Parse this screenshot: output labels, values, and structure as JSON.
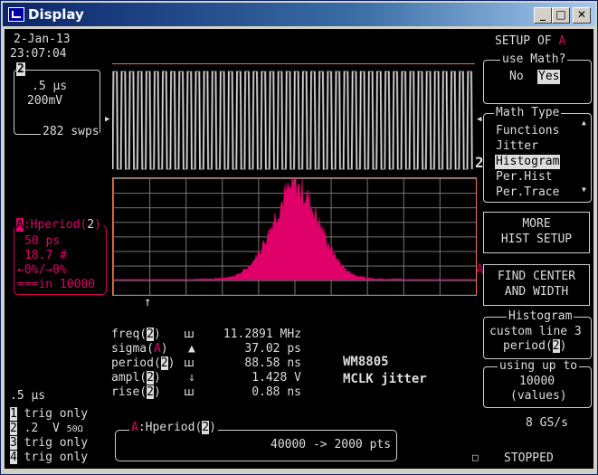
{
  "window": {
    "title": "Display"
  },
  "header": {
    "date": "2-Jan-13",
    "time": "23:07:04",
    "setup": "SETUP OF",
    "setup_trace": "A"
  },
  "channel_box": {
    "number": "2",
    "timebase": ".5 μs",
    "volts": "200mV",
    "sweeps": "282 swps"
  },
  "waveform_marker": "2",
  "hist_marker": "A",
  "param_box": {
    "letter": "A",
    "label": ":Hperiod(",
    "chan": "2",
    "close": ")",
    "bin": "50 ps",
    "count": "18.7 #",
    "range": "←0%/→0%",
    "total": "===in 10000"
  },
  "measurements": [
    {
      "name": "freq(",
      "ch": "2",
      "close": ")",
      "icon": "ꟺ",
      "value": "11.2891 MHz",
      "magenta": false
    },
    {
      "name": "sigma(",
      "ch": "A",
      "close": ")",
      "icon": "▲",
      "value": "37.02 ps",
      "magenta": true
    },
    {
      "name": "period(",
      "ch": "2",
      "close": ")",
      "icon": "ꟺ",
      "value": "88.58 ns",
      "magenta": false
    },
    {
      "name": "ampl(",
      "ch": "2",
      "close": ")",
      "icon": "⇓",
      "value": "1.428 V",
      "magenta": false
    },
    {
      "name": "rise(",
      "ch": "2",
      "close": ")",
      "icon": "ꟺ",
      "value": "0.88 ns",
      "magenta": false
    }
  ],
  "annotation": {
    "line1": "WM8805",
    "line2": "MCLK jitter"
  },
  "bottom_left": {
    "timebase": ".5 μs",
    "ch1": "trig only",
    "ch2_volts": ".2  V",
    "ch2_imp": "50Ω",
    "ch3": "trig only",
    "ch4": "trig only"
  },
  "bottom_box": {
    "letter": "A",
    "label": ":Hperiod(",
    "chan": "2",
    "close": ")",
    "value": "40000 -> 2000 pts"
  },
  "sample_rate": "8 GS/s",
  "status": "STOPPED",
  "menu": {
    "use_math": {
      "title": "use Math?",
      "no": "No",
      "yes": "Yes"
    },
    "math_type": {
      "title": "Math Type",
      "options": [
        "Functions",
        "Jitter",
        "Histogram",
        "Per.Hist",
        "Per.Trace"
      ],
      "selected": "Histogram"
    },
    "more_hist": [
      "MORE",
      "HIST SETUP"
    ],
    "find_center": [
      "FIND CENTER",
      "AND WIDTH"
    ],
    "histogram": {
      "title": "Histogram",
      "line1": "custom line 3",
      "line2_name": "period(",
      "line2_ch": "2",
      "line2_close": ")"
    },
    "using": {
      "title": "using up to",
      "value": "10000",
      "unit": "(values)"
    }
  },
  "colors": {
    "histogram": "#e0006a",
    "accent_magenta": "#d40060",
    "grid": "#777777",
    "border": "#e87040"
  }
}
